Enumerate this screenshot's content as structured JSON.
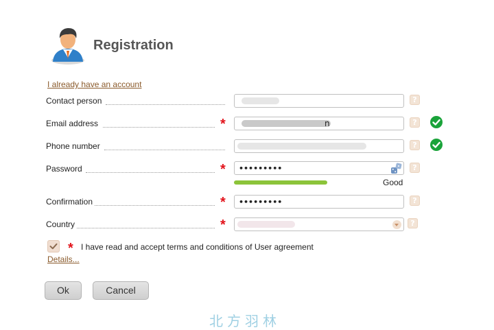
{
  "header": {
    "title": "Registration",
    "avatar_icon": "user-avatar-icon"
  },
  "account_link": "I already have an account",
  "fields": {
    "contact": {
      "label": "Contact person",
      "required": false,
      "value": ""
    },
    "email": {
      "label": "Email address",
      "required": true,
      "value": "",
      "suffix": "n",
      "validated": true
    },
    "phone": {
      "label": "Phone number",
      "required": false,
      "value": "",
      "validated": true
    },
    "password": {
      "label": "Password",
      "required": true,
      "masked": "•••••••••",
      "strength": 0.55,
      "strength_label": "Good"
    },
    "confirmation": {
      "label": "Confirmation",
      "required": true,
      "masked": "•••••••••"
    },
    "country": {
      "label": "Country",
      "required": true,
      "value": ""
    }
  },
  "required_mark": "*",
  "help_mark": "?",
  "agreement": {
    "checked": true,
    "text": "I have read and accept terms and conditions of User agreement",
    "details_link": "Details..."
  },
  "buttons": {
    "ok": "Ok",
    "cancel": "Cancel"
  },
  "watermark": "北方羽林",
  "colors": {
    "required": "#e2131b",
    "valid": "#1aa33a",
    "strength": "#8cc43a",
    "link": "#8a5a2b"
  }
}
